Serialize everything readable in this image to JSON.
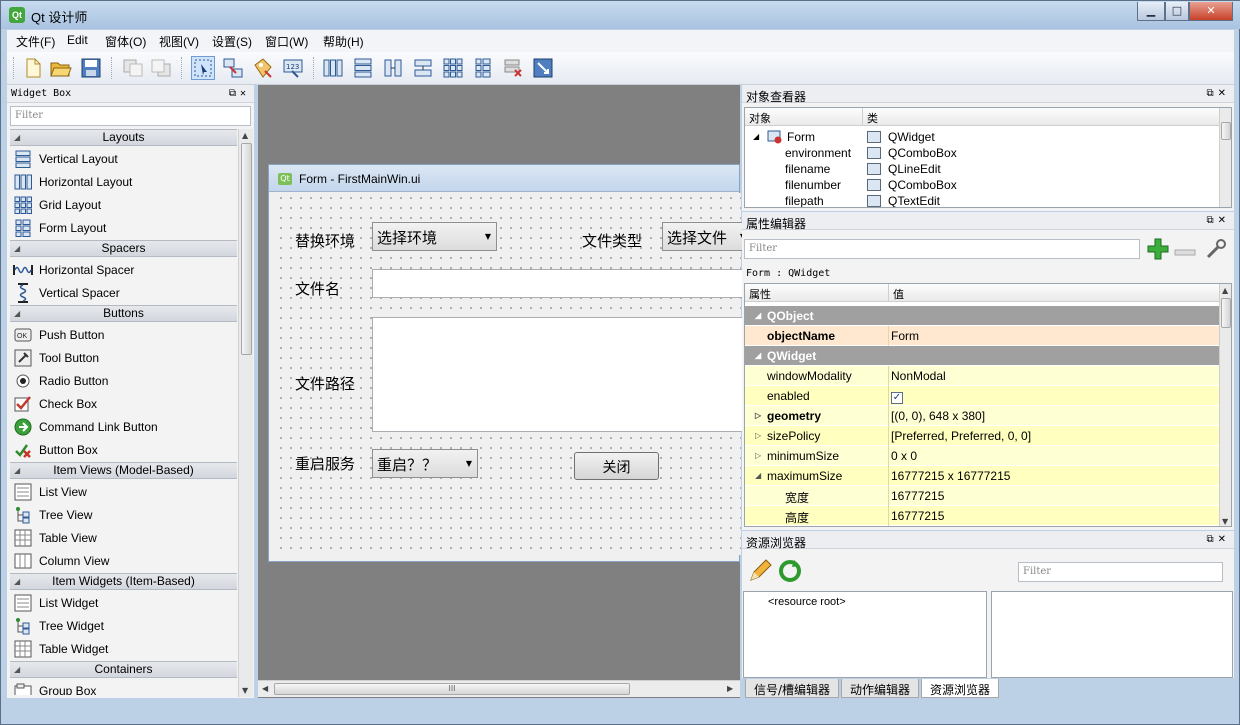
{
  "window": {
    "title": "Qt 设计师",
    "min_glyph": "▁",
    "max_glyph": "□",
    "close_glyph": "✕"
  },
  "menu": [
    "文件(F)",
    "Edit",
    "窗体(O)",
    "视图(V)",
    "设置(S)",
    "窗口(W)",
    "帮助(H)"
  ],
  "widget_box": {
    "title": "Widget Box",
    "filter_placeholder": "Filter",
    "categories": {
      "layouts": "Layouts",
      "spacers": "Spacers",
      "buttons": "Buttons",
      "item_views": "Item Views (Model-Based)",
      "item_widgets": "Item Widgets (Item-Based)",
      "containers": "Containers"
    },
    "items": {
      "vertical_layout": "Vertical Layout",
      "horizontal_layout": "Horizontal Layout",
      "grid_layout": "Grid Layout",
      "form_layout": "Form Layout",
      "horizontal_spacer": "Horizontal Spacer",
      "vertical_spacer": "Vertical Spacer",
      "push_button": "Push Button",
      "tool_button": "Tool Button",
      "radio_button": "Radio Button",
      "check_box": "Check Box",
      "command_link_button": "Command Link Button",
      "button_box": "Button Box",
      "list_view": "List View",
      "tree_view": "Tree View",
      "table_view": "Table View",
      "column_view": "Column View",
      "list_widget": "List Widget",
      "tree_widget": "Tree Widget",
      "table_widget": "Table Widget",
      "group_box": "Group Box"
    }
  },
  "form": {
    "title": "Form - FirstMainWin.ui",
    "env_label": "替换环境",
    "env_combo": "选择环境",
    "filetype_label": "文件类型",
    "filetype_combo": "选择文件",
    "filename_label": "文件名",
    "filepath_label": "文件路径",
    "restart_label": "重启服务",
    "restart_combo": "重启？？",
    "close_button": "关闭"
  },
  "object_inspector": {
    "title": "对象查看器",
    "col_object": "对象",
    "col_class": "类",
    "rows": [
      {
        "object": "Form",
        "class": "QWidget"
      },
      {
        "object": "environment",
        "class": "QComboBox"
      },
      {
        "object": "filename",
        "class": "QLineEdit"
      },
      {
        "object": "filenumber",
        "class": "QComboBox"
      },
      {
        "object": "filepath",
        "class": "QTextEdit"
      }
    ]
  },
  "property_editor": {
    "title": "属性编辑器",
    "filter_placeholder": "Filter",
    "context": "Form : QWidget",
    "col_property": "属性",
    "col_value": "值",
    "rows": {
      "g_qobject": "QObject",
      "objectname_k": "objectName",
      "objectname_v": "Form",
      "g_qwidget": "QWidget",
      "modality_k": "windowModality",
      "modality_v": "NonModal",
      "enabled_k": "enabled",
      "enabled_check": "✓",
      "geometry_k": "geometry",
      "geometry_v": "[(0, 0), 648 x 380]",
      "sizepolicy_k": "sizePolicy",
      "sizepolicy_v": "[Preferred, Preferred, 0, 0]",
      "minsize_k": "minimumSize",
      "minsize_v": "0 x 0",
      "maxsize_k": "maximumSize",
      "maxsize_v": "16777215 x 16777215",
      "width_k": "宽度",
      "width_v": "16777215",
      "height_k": "高度",
      "height_v": "16777215"
    }
  },
  "resource_browser": {
    "title": "资源浏览器",
    "filter_placeholder": "Filter",
    "root": "<resource root>"
  },
  "bottom_tabs": [
    "信号/槽编辑器",
    "动作编辑器",
    "资源浏览器"
  ],
  "hscroll_grip": "III"
}
